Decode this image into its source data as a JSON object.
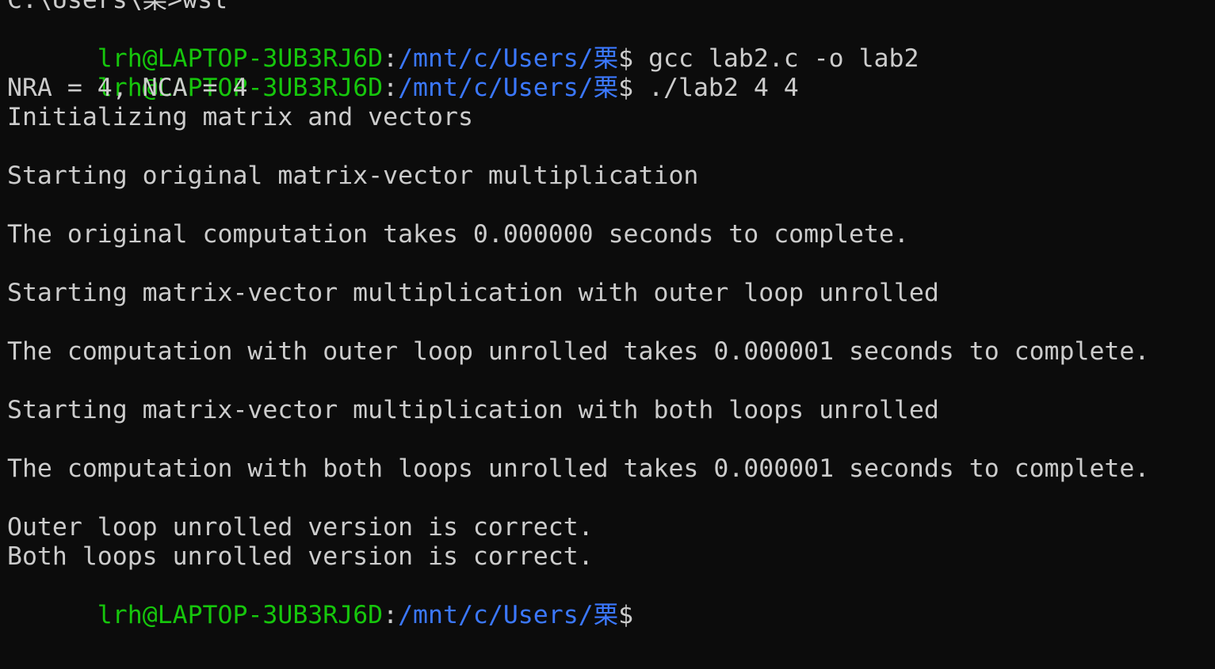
{
  "terminal": {
    "prompt": {
      "user_host": "lrh@LAPTOP-3UB3RJ6D",
      "separator": ":",
      "cwd": "/mnt/c/Users/栗",
      "symbol": "$"
    },
    "top_line": "C:\\Users\\栗>wsl",
    "commands": [
      " gcc lab2.c -o lab2",
      " ./lab2 4 4"
    ],
    "output": [
      "NRA = 4, NCA = 4",
      "Initializing matrix and vectors",
      "",
      "Starting original matrix-vector multiplication",
      "",
      "The original computation takes 0.000000 seconds to complete.",
      "",
      "Starting matrix-vector multiplication with outer loop unrolled",
      "",
      "The computation with outer loop unrolled takes 0.000001 seconds to complete.",
      "",
      "Starting matrix-vector multiplication with both loops unrolled",
      "",
      "The computation with both loops unrolled takes 0.000001 seconds to complete.",
      "",
      "Outer loop unrolled version is correct.",
      "Both loops unrolled version is correct."
    ],
    "colors": {
      "background": "#0c0c0c",
      "text": "#cccccc",
      "user_host": "#16c60c",
      "path": "#3b78ff"
    }
  }
}
